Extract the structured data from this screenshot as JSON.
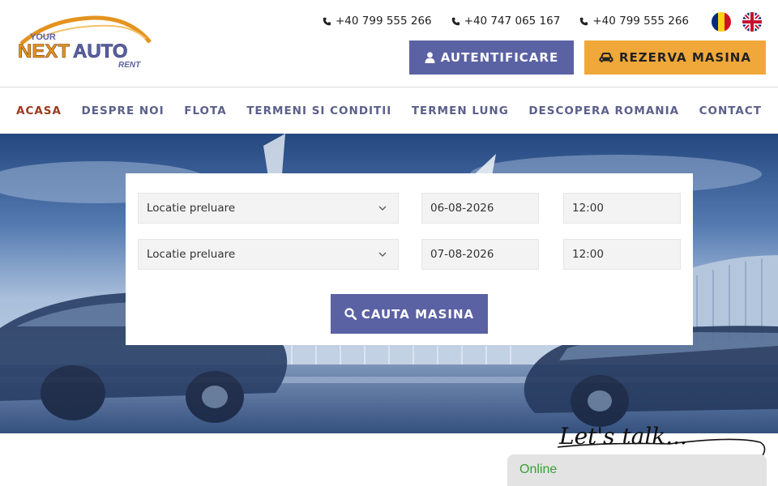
{
  "header": {
    "logo": {
      "word_your": "YOUR",
      "word_next": "NEXT",
      "word_auto": "AUTO",
      "word_rent": "RENT"
    },
    "phones": [
      "+40 799 555 266",
      "+40 747 065 167",
      "+40 799 555 266"
    ],
    "flags": [
      "romania-flag-icon",
      "uk-flag-icon"
    ],
    "auth_label": "AUTENTIFICARE",
    "book_label": "REZERVA MASINA"
  },
  "nav": {
    "items": [
      "ACASA",
      "DESPRE NOI",
      "FLOTA",
      "TERMENI SI CONDITII",
      "TERMEN LUNG",
      "DESCOPERA ROMANIA",
      "CONTACT"
    ],
    "active_index": 0
  },
  "search": {
    "pickup_location": "Locatie preluare",
    "return_location": "Locatie preluare",
    "pickup_date": "06-08-2026",
    "pickup_time": "12:00",
    "return_date": "07-08-2026",
    "return_time": "12:00",
    "button_label": "CAUTA MASINA"
  },
  "chat": {
    "headline": "Let's talk...",
    "status": "Online"
  },
  "colors": {
    "primary": "#5b62a3",
    "accent": "#f0a83a",
    "nav_text": "#5b5f8a",
    "nav_active": "#9b3a1e",
    "online": "#3a9d3a"
  }
}
